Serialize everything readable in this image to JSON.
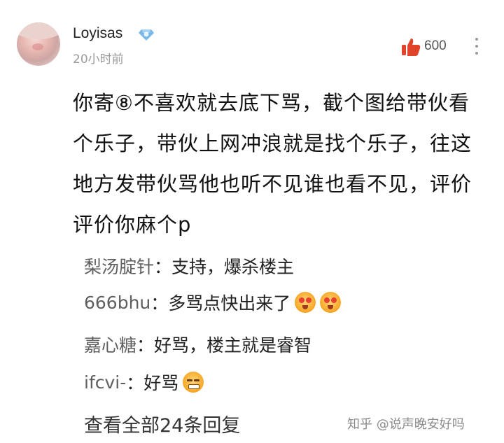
{
  "post": {
    "username": "Loyisas",
    "time": "20小时前",
    "like_count": "600",
    "text": "你寄⑧不喜欢就去底下骂，截个图给带伙看个乐子，带伙上网冲浪就是找个乐子，往这地方发带伙骂他也听不见谁也看不见，评价评价你麻个p"
  },
  "replies": [
    {
      "name": "梨汤腚针",
      "text": "支持，爆杀楼主",
      "emojis": []
    },
    {
      "name": "666bhu",
      "text": "多骂点快出来了",
      "emojis": [
        "starstruck-emoji",
        "starstruck-emoji"
      ]
    },
    {
      "name": "嘉心糖",
      "text": "好骂，楼主就是睿智",
      "emojis": []
    },
    {
      "name": "ifcvi-",
      "text": "好骂",
      "emojis": [
        "grimace-emoji"
      ]
    }
  ],
  "reply_separator": "：",
  "view_all": "查看全部24条回复",
  "watermark": "知乎 @说声晚安好吗",
  "colors": {
    "like": "#e0452b",
    "badge": "#7ab8e8"
  }
}
